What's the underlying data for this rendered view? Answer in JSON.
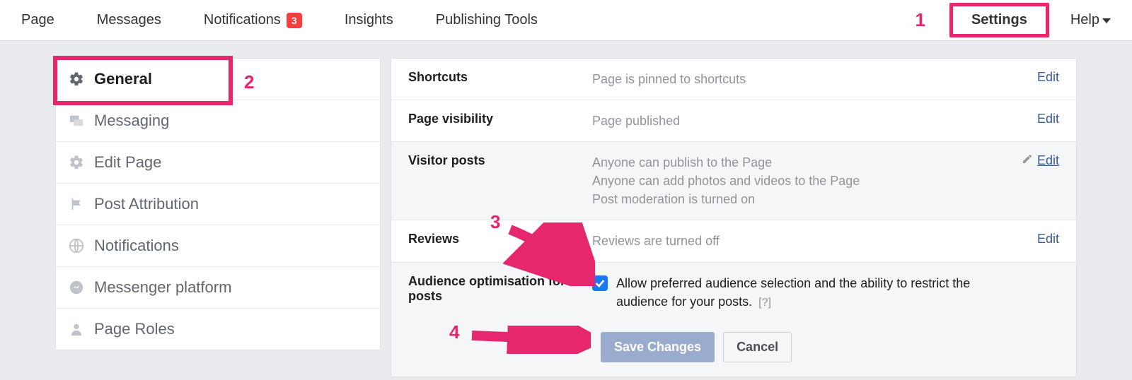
{
  "topnav": {
    "items": [
      {
        "label": "Page"
      },
      {
        "label": "Messages"
      },
      {
        "label": "Notifications",
        "badge": "3"
      },
      {
        "label": "Insights"
      },
      {
        "label": "Publishing Tools"
      }
    ],
    "settings_label": "Settings",
    "help_label": "Help"
  },
  "annotations": {
    "n1": "1",
    "n2": "2",
    "n3": "3",
    "n4": "4"
  },
  "sidebar": {
    "items": [
      {
        "label": "General",
        "icon": "gear-icon",
        "active": true
      },
      {
        "label": "Messaging",
        "icon": "messaging-icon"
      },
      {
        "label": "Edit Page",
        "icon": "gear-icon"
      },
      {
        "label": "Post Attribution",
        "icon": "flag-icon"
      },
      {
        "label": "Notifications",
        "icon": "globe-icon"
      },
      {
        "label": "Messenger platform",
        "icon": "messenger-icon"
      },
      {
        "label": "Page Roles",
        "icon": "person-icon"
      }
    ]
  },
  "settings": {
    "shortcuts": {
      "label": "Shortcuts",
      "value": "Page is pinned to shortcuts",
      "edit": "Edit"
    },
    "visibility": {
      "label": "Page visibility",
      "value": "Page published",
      "edit": "Edit"
    },
    "visitor": {
      "label": "Visitor posts",
      "value_lines": [
        "Anyone can publish to the Page",
        "Anyone can add photos and videos to the Page",
        "Post moderation is turned on"
      ],
      "edit": "Edit"
    },
    "reviews": {
      "label": "Reviews",
      "value": "Reviews are turned off",
      "edit": "Edit"
    },
    "audience": {
      "label": "Audience optimisation for posts",
      "checkbox_checked": true,
      "text": "Allow preferred audience selection and the ability to restrict the audience for your posts.",
      "help": "[?]"
    },
    "buttons": {
      "save": "Save Changes",
      "cancel": "Cancel"
    }
  }
}
